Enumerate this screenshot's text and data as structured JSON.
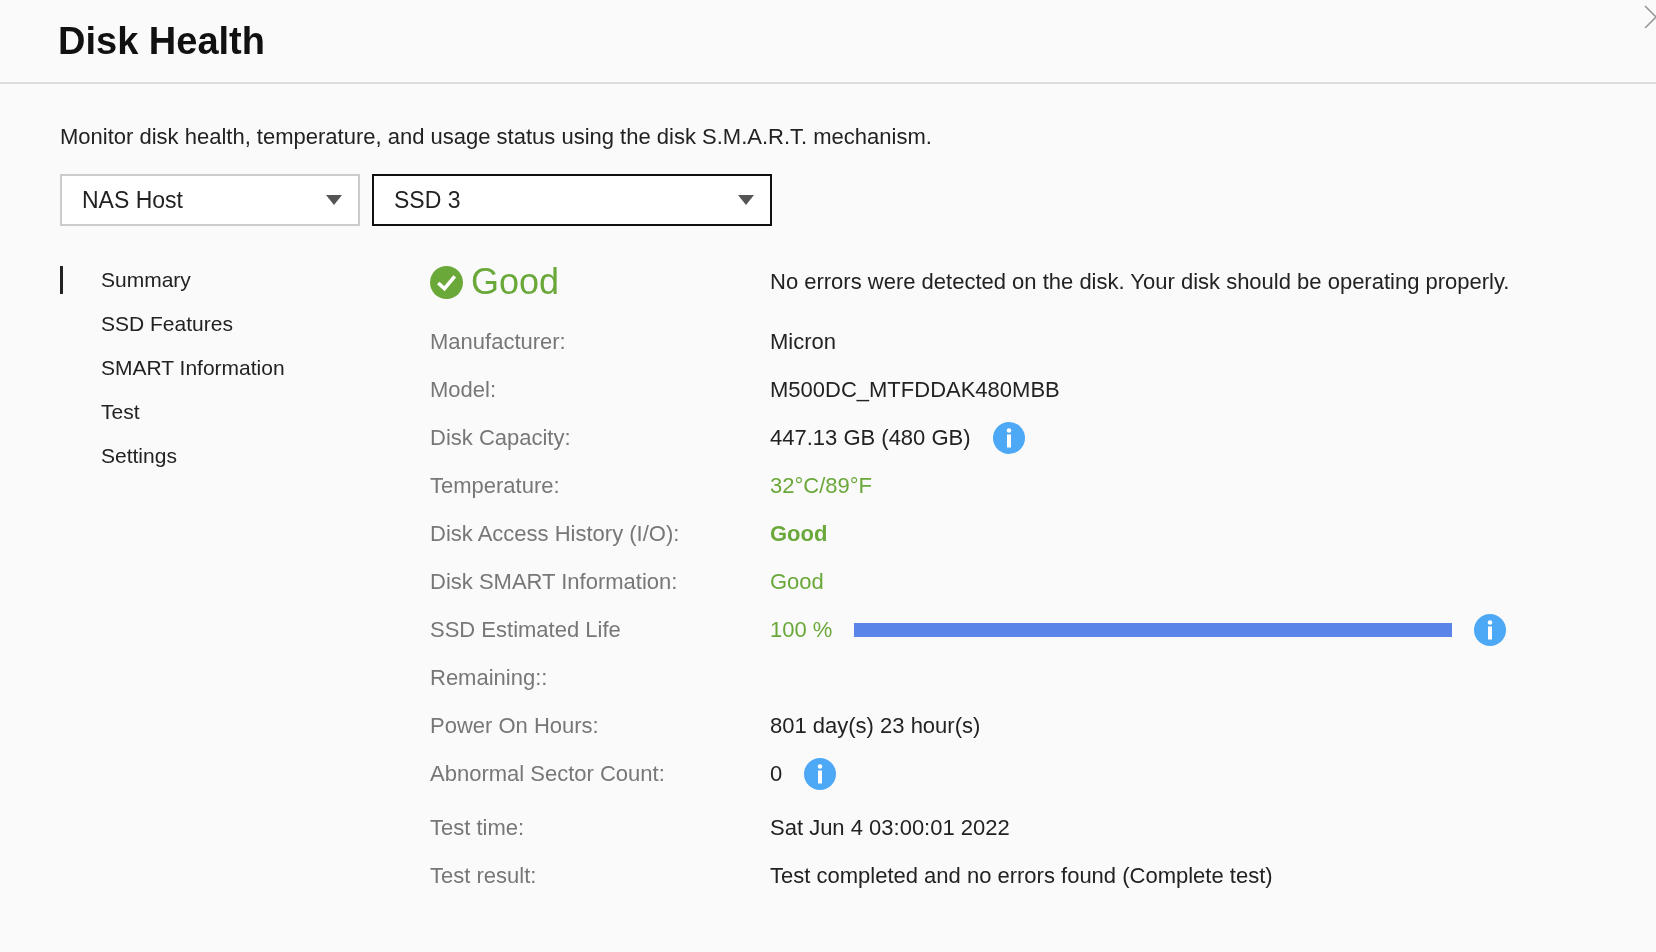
{
  "window": {
    "title": "Disk Health"
  },
  "description": "Monitor disk health, temperature, and usage status using the disk S.M.A.R.T. mechanism.",
  "dropdowns": [
    {
      "value": "NAS Host",
      "focused": false
    },
    {
      "value": "SSD 3",
      "focused": true
    }
  ],
  "sidebar": {
    "items": [
      {
        "label": "Summary",
        "selected": true
      },
      {
        "label": "SSD Features",
        "selected": false
      },
      {
        "label": "SMART Information",
        "selected": false
      },
      {
        "label": "Test",
        "selected": false
      },
      {
        "label": "Settings",
        "selected": false
      }
    ]
  },
  "status": {
    "label": "Good",
    "message": "No errors were detected on the disk. Your disk should be operating properly."
  },
  "details": [
    {
      "kind": "plain",
      "label": "Manufacturer:",
      "value": "Micron",
      "info": false
    },
    {
      "kind": "plain",
      "label": "Model:",
      "value": "M500DC_MTFDDAK480MBB",
      "info": false
    },
    {
      "kind": "plain",
      "label": "Disk Capacity:",
      "value": "447.13 GB (480 GB)",
      "info": true
    },
    {
      "kind": "good",
      "label": "Temperature:",
      "value": "32°C/89°F",
      "info": false
    },
    {
      "kind": "strong",
      "label": "Disk Access History (I/O):",
      "value": "Good",
      "info": false
    },
    {
      "kind": "good",
      "label": "Disk SMART Information:",
      "value": "Good",
      "info": false
    },
    {
      "kind": "meter",
      "label": "SSD Estimated Life Remaining::",
      "value": "100 %",
      "info": true,
      "level": 1
    },
    {
      "kind": "plain",
      "label": "Power On Hours:",
      "value": "801 day(s) 23 hour(s)",
      "info": false
    },
    {
      "kind": "plain",
      "label": "Abnormal Sector Count:",
      "value": "0",
      "info": true
    },
    {
      "kind": "plain",
      "label": "Test time:",
      "value": "Sat Jun 4 03:00:01 2022",
      "info": false
    },
    {
      "kind": "plain",
      "label": "Test result:",
      "value": "Test completed and no errors found (Complete test)",
      "info": false
    }
  ]
}
